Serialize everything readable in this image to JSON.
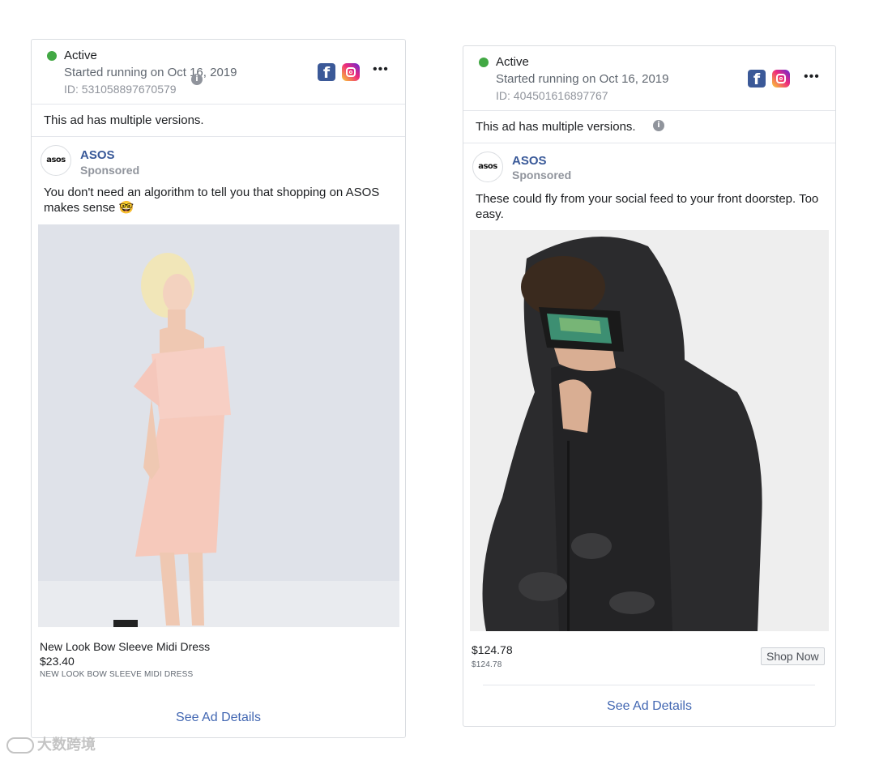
{
  "ads": [
    {
      "status": "Active",
      "started": "Started running on Oct 16, 2019",
      "id_text": "ID: 531058897670579",
      "platforms": [
        "facebook-icon",
        "instagram-icon"
      ],
      "versions_notice": "This ad has multiple versions.",
      "page_name": "ASOS",
      "avatar_text": "asos",
      "sponsored": "Sponsored",
      "body": "You don't need an algorithm to tell you that shopping on ASOS makes sense 🤓",
      "product_name": "New Look Bow Sleeve Midi Dress",
      "price": "$23.40",
      "caption": "NEW LOOK BOW SLEEVE MIDI DRESS",
      "details_link": "See Ad Details"
    },
    {
      "status": "Active",
      "started": "Started running on Oct 16, 2019",
      "id_text": "ID: 404501616897767",
      "platforms": [
        "facebook-icon",
        "instagram-icon"
      ],
      "versions_notice": "This ad has multiple versions.",
      "page_name": "ASOS",
      "avatar_text": "asos",
      "sponsored": "Sponsored",
      "body": "These could fly from your social feed to your front doorstep. Too easy.",
      "price": "$124.78",
      "caption": "$124.78",
      "cta": "Shop Now",
      "details_link": "See Ad Details"
    }
  ],
  "colors": {
    "active_dot": "#42a844",
    "link": "#4267b2",
    "page_name": "#385898",
    "facebook": "#3b5998"
  },
  "watermark": "大数跨境"
}
